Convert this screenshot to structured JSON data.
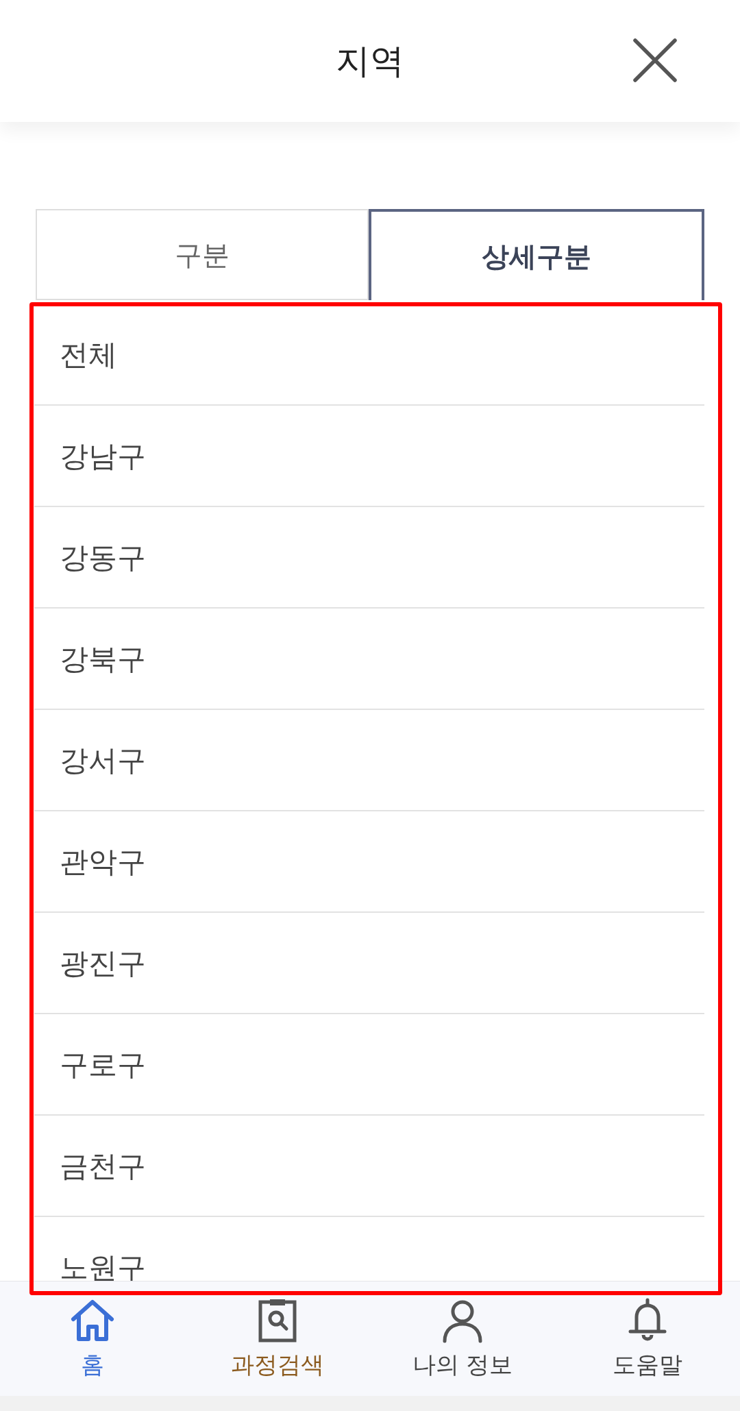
{
  "header": {
    "title": "지역"
  },
  "tabs": [
    {
      "label": "구분",
      "selected": false
    },
    {
      "label": "상세구분",
      "selected": true
    }
  ],
  "list": {
    "outlined": true,
    "items": [
      {
        "label": "전체",
        "selected": false
      },
      {
        "label": "강남구",
        "selected": false
      },
      {
        "label": "강동구",
        "selected": false
      },
      {
        "label": "강북구",
        "selected": false
      },
      {
        "label": "강서구",
        "selected": false
      },
      {
        "label": "관악구",
        "selected": false
      },
      {
        "label": "광진구",
        "selected": false
      },
      {
        "label": "구로구",
        "selected": false
      },
      {
        "label": "금천구",
        "selected": false
      },
      {
        "label": "노원구",
        "selected": false
      }
    ]
  },
  "bottom_nav": [
    {
      "kind": "home",
      "label": "홈",
      "selected": true,
      "color": "#3b6fd6"
    },
    {
      "kind": "search",
      "label": "과정검색",
      "selected": false,
      "color": "#8b5a1e"
    },
    {
      "kind": "profile",
      "label": "나의 정보",
      "selected": false,
      "color": "#444444"
    },
    {
      "kind": "help",
      "label": "도움말",
      "selected": false,
      "color": "#444444"
    }
  ]
}
